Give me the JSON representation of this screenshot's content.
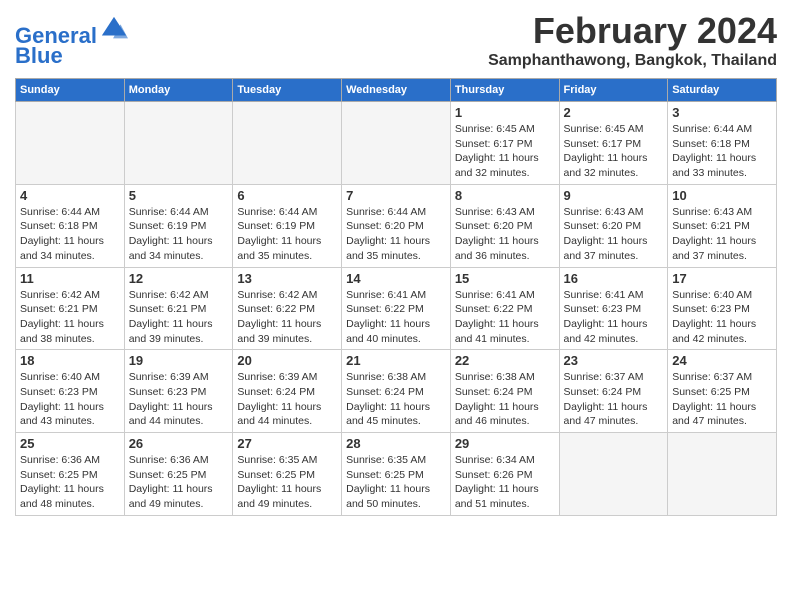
{
  "header": {
    "logo_line1": "General",
    "logo_line2": "Blue",
    "month_year": "February 2024",
    "location": "Samphanthawong, Bangkok, Thailand"
  },
  "days_of_week": [
    "Sunday",
    "Monday",
    "Tuesday",
    "Wednesday",
    "Thursday",
    "Friday",
    "Saturday"
  ],
  "weeks": [
    [
      {
        "day": "",
        "info": ""
      },
      {
        "day": "",
        "info": ""
      },
      {
        "day": "",
        "info": ""
      },
      {
        "day": "",
        "info": ""
      },
      {
        "day": "1",
        "info": "Sunrise: 6:45 AM\nSunset: 6:17 PM\nDaylight: 11 hours\nand 32 minutes."
      },
      {
        "day": "2",
        "info": "Sunrise: 6:45 AM\nSunset: 6:17 PM\nDaylight: 11 hours\nand 32 minutes."
      },
      {
        "day": "3",
        "info": "Sunrise: 6:44 AM\nSunset: 6:18 PM\nDaylight: 11 hours\nand 33 minutes."
      }
    ],
    [
      {
        "day": "4",
        "info": "Sunrise: 6:44 AM\nSunset: 6:18 PM\nDaylight: 11 hours\nand 34 minutes."
      },
      {
        "day": "5",
        "info": "Sunrise: 6:44 AM\nSunset: 6:19 PM\nDaylight: 11 hours\nand 34 minutes."
      },
      {
        "day": "6",
        "info": "Sunrise: 6:44 AM\nSunset: 6:19 PM\nDaylight: 11 hours\nand 35 minutes."
      },
      {
        "day": "7",
        "info": "Sunrise: 6:44 AM\nSunset: 6:20 PM\nDaylight: 11 hours\nand 35 minutes."
      },
      {
        "day": "8",
        "info": "Sunrise: 6:43 AM\nSunset: 6:20 PM\nDaylight: 11 hours\nand 36 minutes."
      },
      {
        "day": "9",
        "info": "Sunrise: 6:43 AM\nSunset: 6:20 PM\nDaylight: 11 hours\nand 37 minutes."
      },
      {
        "day": "10",
        "info": "Sunrise: 6:43 AM\nSunset: 6:21 PM\nDaylight: 11 hours\nand 37 minutes."
      }
    ],
    [
      {
        "day": "11",
        "info": "Sunrise: 6:42 AM\nSunset: 6:21 PM\nDaylight: 11 hours\nand 38 minutes."
      },
      {
        "day": "12",
        "info": "Sunrise: 6:42 AM\nSunset: 6:21 PM\nDaylight: 11 hours\nand 39 minutes."
      },
      {
        "day": "13",
        "info": "Sunrise: 6:42 AM\nSunset: 6:22 PM\nDaylight: 11 hours\nand 39 minutes."
      },
      {
        "day": "14",
        "info": "Sunrise: 6:41 AM\nSunset: 6:22 PM\nDaylight: 11 hours\nand 40 minutes."
      },
      {
        "day": "15",
        "info": "Sunrise: 6:41 AM\nSunset: 6:22 PM\nDaylight: 11 hours\nand 41 minutes."
      },
      {
        "day": "16",
        "info": "Sunrise: 6:41 AM\nSunset: 6:23 PM\nDaylight: 11 hours\nand 42 minutes."
      },
      {
        "day": "17",
        "info": "Sunrise: 6:40 AM\nSunset: 6:23 PM\nDaylight: 11 hours\nand 42 minutes."
      }
    ],
    [
      {
        "day": "18",
        "info": "Sunrise: 6:40 AM\nSunset: 6:23 PM\nDaylight: 11 hours\nand 43 minutes."
      },
      {
        "day": "19",
        "info": "Sunrise: 6:39 AM\nSunset: 6:23 PM\nDaylight: 11 hours\nand 44 minutes."
      },
      {
        "day": "20",
        "info": "Sunrise: 6:39 AM\nSunset: 6:24 PM\nDaylight: 11 hours\nand 44 minutes."
      },
      {
        "day": "21",
        "info": "Sunrise: 6:38 AM\nSunset: 6:24 PM\nDaylight: 11 hours\nand 45 minutes."
      },
      {
        "day": "22",
        "info": "Sunrise: 6:38 AM\nSunset: 6:24 PM\nDaylight: 11 hours\nand 46 minutes."
      },
      {
        "day": "23",
        "info": "Sunrise: 6:37 AM\nSunset: 6:24 PM\nDaylight: 11 hours\nand 47 minutes."
      },
      {
        "day": "24",
        "info": "Sunrise: 6:37 AM\nSunset: 6:25 PM\nDaylight: 11 hours\nand 47 minutes."
      }
    ],
    [
      {
        "day": "25",
        "info": "Sunrise: 6:36 AM\nSunset: 6:25 PM\nDaylight: 11 hours\nand 48 minutes."
      },
      {
        "day": "26",
        "info": "Sunrise: 6:36 AM\nSunset: 6:25 PM\nDaylight: 11 hours\nand 49 minutes."
      },
      {
        "day": "27",
        "info": "Sunrise: 6:35 AM\nSunset: 6:25 PM\nDaylight: 11 hours\nand 49 minutes."
      },
      {
        "day": "28",
        "info": "Sunrise: 6:35 AM\nSunset: 6:25 PM\nDaylight: 11 hours\nand 50 minutes."
      },
      {
        "day": "29",
        "info": "Sunrise: 6:34 AM\nSunset: 6:26 PM\nDaylight: 11 hours\nand 51 minutes."
      },
      {
        "day": "",
        "info": ""
      },
      {
        "day": "",
        "info": ""
      }
    ]
  ]
}
